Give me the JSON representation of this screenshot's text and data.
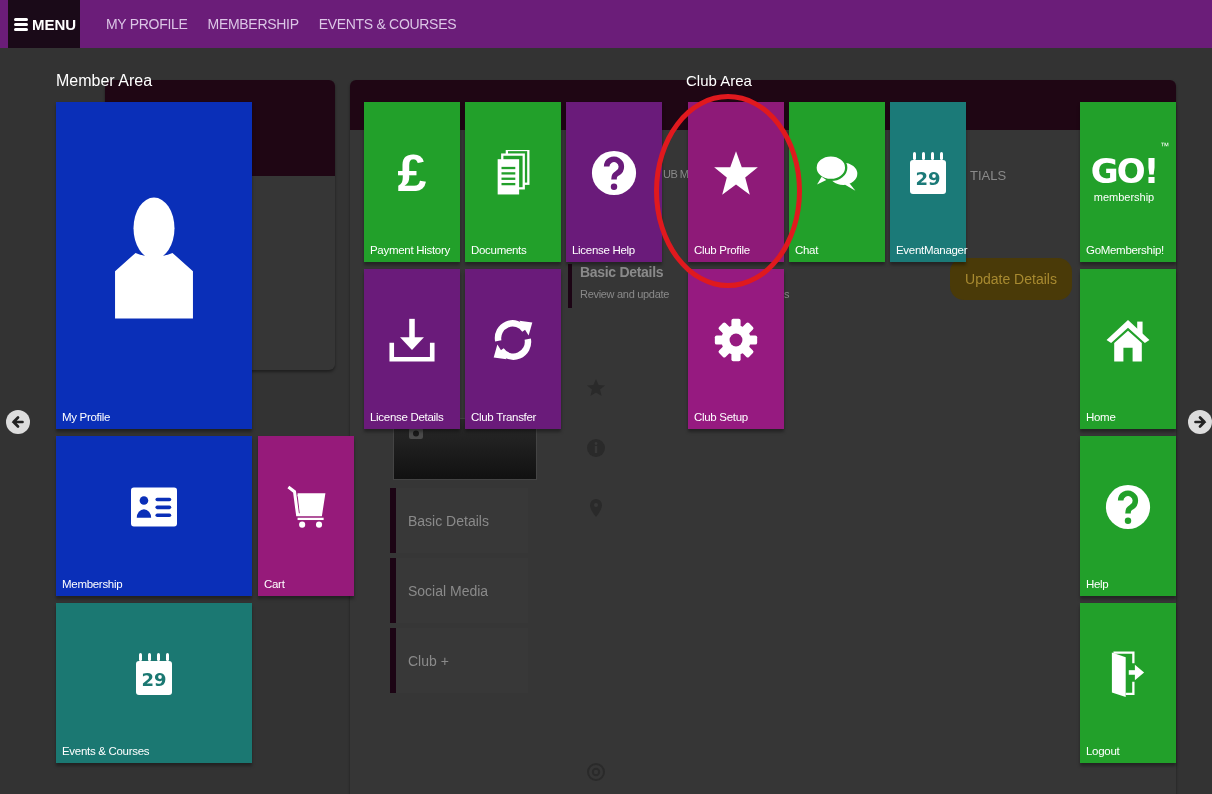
{
  "nav": {
    "menu_label": "MENU",
    "links": [
      "MY PROFILE",
      "MEMBERSHIP",
      "EVENTS & COURSES"
    ]
  },
  "page_behind": {
    "tab_fragments": [
      "UB M",
      "TIALS"
    ],
    "section_title": "Basic Details",
    "section_text": [
      "Review and update",
      "s"
    ],
    "update_button": "Update Details",
    "side_menu": [
      "Basic Details",
      "Social Media",
      "Club +"
    ]
  },
  "member_area": {
    "title": "Member Area",
    "tiles": [
      {
        "label": "My Profile",
        "color": "#0a2fb8",
        "highlighted": false
      },
      {
        "label": "Membership",
        "color": "#0a2fb8",
        "highlighted": false
      },
      {
        "label": "Cart",
        "color": "#961a7a",
        "highlighted": false
      },
      {
        "label": "Events & Courses",
        "color": "#1b7872",
        "highlighted": false,
        "day": "29"
      }
    ]
  },
  "club_area": {
    "title": "Club Area",
    "tiles": [
      {
        "label": "Payment History",
        "color": "#22a02a",
        "highlighted": false,
        "glyph": "£"
      },
      {
        "label": "Documents",
        "color": "#22a02a",
        "highlighted": false
      },
      {
        "label": "License Help",
        "color": "#6a1b7a",
        "highlighted": false
      },
      {
        "label": "Club Profile",
        "color": "#8e1a78",
        "highlighted": true
      },
      {
        "label": "Chat",
        "color": "#22a02a",
        "highlighted": false
      },
      {
        "label": "EventManager",
        "color": "#1b7a78",
        "highlighted": false,
        "day": "29"
      },
      {
        "label": "License Details",
        "color": "#6a1b7a",
        "highlighted": false
      },
      {
        "label": "Club Transfer",
        "color": "#6a1b7a",
        "highlighted": false
      },
      {
        "label": "Club Setup",
        "color": "#961a80",
        "highlighted": false
      }
    ]
  },
  "quick_links": {
    "tiles": [
      {
        "label": "GoMembership!",
        "color": "#22a02a",
        "highlighted": false,
        "logo": {
          "word": "GO!",
          "sub": "membership",
          "tm": "™"
        }
      },
      {
        "label": "Home",
        "color": "#22a02a",
        "highlighted": false
      },
      {
        "label": "Help",
        "color": "#22a02a",
        "highlighted": false
      },
      {
        "label": "Logout",
        "color": "#22a02a",
        "highlighted": false
      }
    ]
  }
}
